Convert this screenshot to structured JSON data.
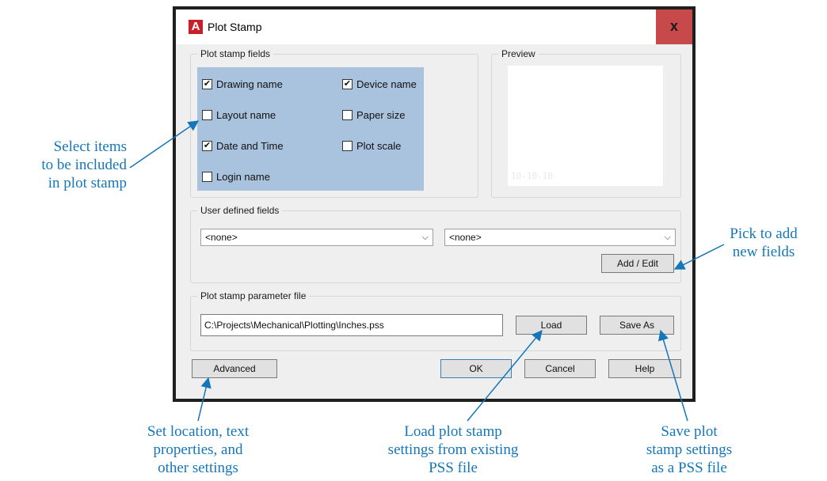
{
  "dialog": {
    "title": "Plot Stamp",
    "close_label": "x",
    "app_icon_letter": "A"
  },
  "plot_stamp_fields": {
    "label": "Plot stamp fields",
    "items": [
      {
        "label": "Drawing name",
        "checked": true
      },
      {
        "label": "Device name",
        "checked": true
      },
      {
        "label": "Layout name",
        "checked": false
      },
      {
        "label": "Paper size",
        "checked": false
      },
      {
        "label": "Date and Time",
        "checked": true
      },
      {
        "label": "Plot scale",
        "checked": false
      },
      {
        "label": "Login name",
        "checked": false
      }
    ]
  },
  "preview": {
    "label": "Preview",
    "stamp_text": "10-10-10"
  },
  "user_defined": {
    "label": "User defined fields",
    "select1": "<none>",
    "select2": "<none>",
    "add_edit": "Add / Edit"
  },
  "parameter_file": {
    "label": "Plot stamp parameter file",
    "path": "C:\\Projects\\Mechanical\\Plotting\\Inches.pss",
    "load": "Load",
    "save_as": "Save As"
  },
  "buttons": {
    "advanced": "Advanced",
    "ok": "OK",
    "cancel": "Cancel",
    "help": "Help"
  },
  "callouts": {
    "select_items": [
      "Select items",
      "to be included",
      "in plot stamp"
    ],
    "pick_add": [
      "Pick to add",
      "new fields"
    ],
    "set_location": [
      "Set location, text",
      "properties, and",
      "other settings"
    ],
    "load_settings": [
      "Load plot stamp",
      "settings from existing",
      "PSS file"
    ],
    "save_settings": [
      "Save plot",
      "stamp settings",
      "as a PSS file"
    ]
  },
  "colors": {
    "callout": "#1677b8",
    "fields_highlight": "#a9c2de",
    "close_button": "#c8494a"
  }
}
